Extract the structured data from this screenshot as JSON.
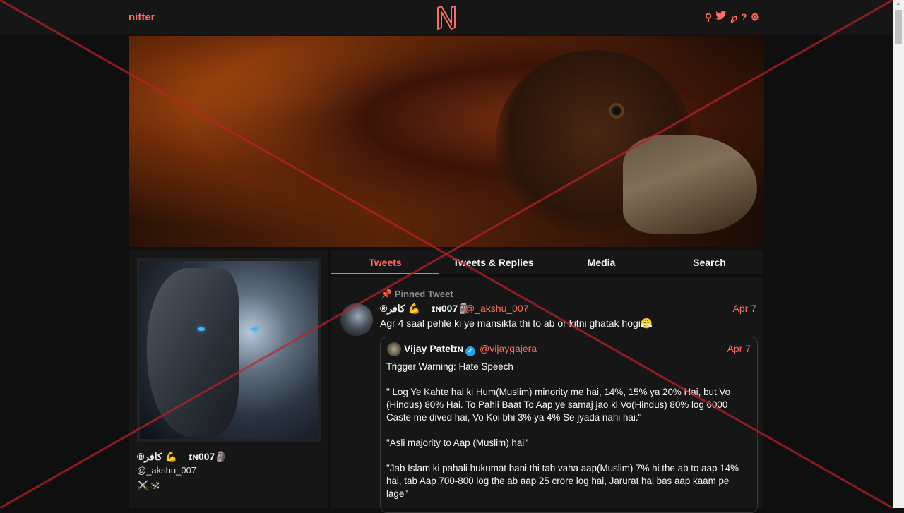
{
  "nav": {
    "brand": "nitter",
    "logo_letter": "N",
    "icons": [
      "search-icon",
      "twitter-icon",
      "rss-icon",
      "help-icon",
      "gear-icon"
    ],
    "icon_glyphs": {
      "search": "⚲",
      "twitter": "🐦",
      "rss": "℘",
      "help": "?",
      "settings": "⚙"
    }
  },
  "profile": {
    "name": "®كافر 💪 _ ɪɴ007🗿",
    "handle": "@_akshu_007",
    "emoji_line": "⚔️ 🕉"
  },
  "tabs": [
    "Tweets",
    "Tweets & Replies",
    "Media",
    "Search"
  ],
  "active_tab": "Tweets",
  "pinned_tweet": {
    "label": "📌 Pinned Tweet",
    "author_name": "®كافر 💪 _ ɪɴ007🗿",
    "author_handle": "@_akshu_007",
    "date": "Apr 7",
    "text": "Agr 4 saal pehle ki ye mansikta thi to ab or kitni ghatak hogi😤",
    "quote": {
      "author_name": "Vijay Patelɪɴ",
      "author_handle": "@vijaygajera",
      "date": "Apr 7",
      "paragraphs": [
        "Trigger Warning: Hate Speech",
        "\" Log Ye Kahte hai ki Hum(Muslim) minority me hai, 14%, 15% ya 20% Hai, but Vo (Hindus) 80% Hai. To Pahli Baat To Aap ye samaj jao ki Vo(Hindus) 80% log 6000 Caste me dived hai, Vo Koi bhi 3% ya 4% Se jyada nahi hai.\"",
        "\"Asli majority to Aap (Muslim) hai\"",
        "\"Jab Islam ki pahali hukumat bani thi tab vaha aap(Muslim) 7% hi the ab to aap 14% hai, tab Aap 700-800 log the ab aap 25 crore log hai, Jarurat hai bas aap kaam pe lage\""
      ]
    }
  },
  "colors": {
    "accent": "#ff6c60",
    "background": "#0f0f0f",
    "panel": "#161616",
    "overlay_cross": "#c0202a"
  }
}
